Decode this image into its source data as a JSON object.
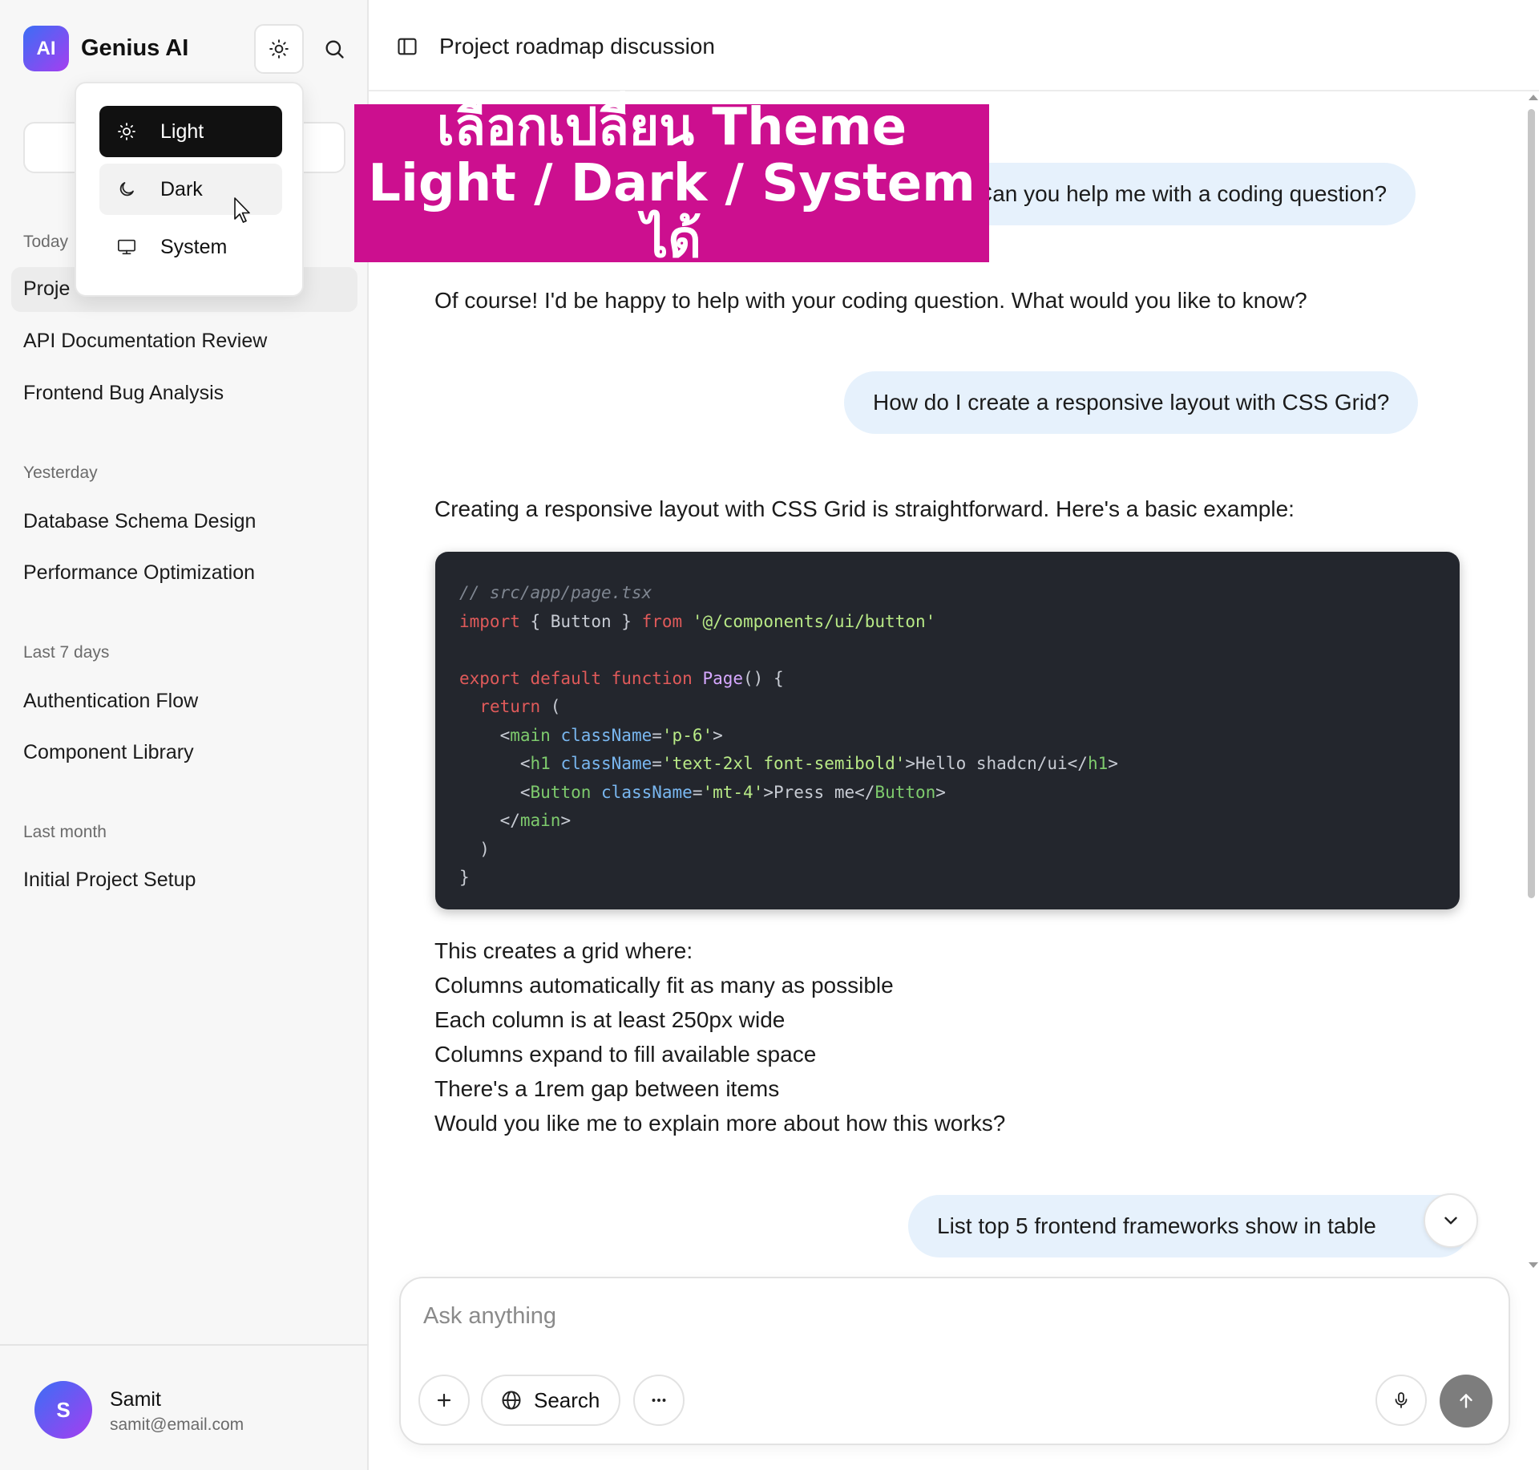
{
  "sidebar": {
    "logo_text": "AI",
    "app_title": "Genius AI",
    "theme_button_icon": "sun-icon",
    "search_button_icon": "search-icon",
    "sections": [
      {
        "label": "Today",
        "items": [
          "Project roadmap discussion",
          "API Documentation Review",
          "Frontend Bug Analysis"
        ]
      },
      {
        "label": "Yesterday",
        "items": [
          "Database Schema Design",
          "Performance Optimization"
        ]
      },
      {
        "label": "Last 7 days",
        "items": [
          "Authentication Flow",
          "Component Library"
        ]
      },
      {
        "label": "Last month",
        "items": [
          "Initial Project Setup"
        ]
      }
    ],
    "active_item_visible_text": "Proje",
    "user": {
      "avatar_letter": "S",
      "name": "Samit",
      "email": "samit@email.com"
    }
  },
  "theme_menu": {
    "selected": "Light",
    "items": [
      {
        "label": "Light",
        "icon": "sun-icon"
      },
      {
        "label": "Dark",
        "icon": "moon-icon"
      },
      {
        "label": "System",
        "icon": "monitor-icon"
      }
    ]
  },
  "banner": {
    "line1": "เลือกเปลี่ยน Theme",
    "line2": "Light / Dark / System ได้",
    "color": "#cc0f8f"
  },
  "main": {
    "title": "Project roadmap discussion",
    "messages": {
      "user1": "Can you help me with a coding question?",
      "assistant1": "Of course! I'd be happy to help with your coding question. What would you like to know?",
      "user2": "How do I create a responsive layout with CSS Grid?",
      "assistant2_intro": "Creating a responsive layout with CSS Grid is straightforward. Here's a basic example:",
      "code_lines": [
        "// src/app/page.tsx",
        "import { Button } from '@/components/ui/button'",
        "",
        "export default function Page() {",
        "  return (",
        "    <main className='p-6'>",
        "      <h1 className='text-2xl font-semibold'>Hello shadcn/ui</h1>",
        "      <Button className='mt-4'>Press me</Button>",
        "    </main>",
        "  )",
        "}"
      ],
      "assistant2_list": [
        "This creates a grid where:",
        "Columns automatically fit as many as possible",
        "Each column is at least 250px wide",
        "Columns expand to fill available space",
        "There's a 1rem gap between items",
        "Would you like me to explain more about how this works?"
      ],
      "user3": "List  top 5 frontend frameworks show in table"
    }
  },
  "composer": {
    "placeholder": "Ask anything",
    "search_label": "Search"
  },
  "colors": {
    "accent_gradient_start": "#3b6ef5",
    "accent_gradient_end": "#a53ef0",
    "user_bubble": "#e6f1fc",
    "code_bg": "#23262d",
    "send_button": "#7d7d7d"
  }
}
